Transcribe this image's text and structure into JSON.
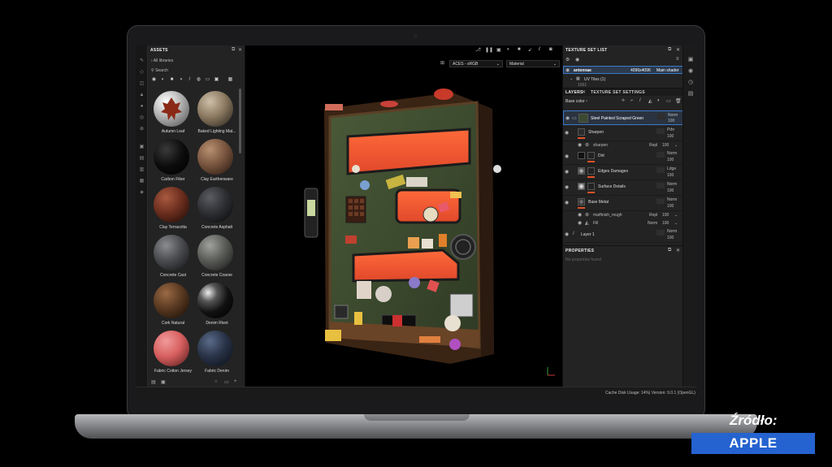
{
  "caption": {
    "source_label": "Źródło:",
    "badge": "APPLE"
  },
  "assets": {
    "title": "ASSETS",
    "library": "All libraries",
    "search_placeholder": "Search",
    "items": [
      {
        "label": "Autumn Leaf",
        "color": "#c8c8c8"
      },
      {
        "label": "Baked Lighting Mat...",
        "color": "#8c7a62"
      },
      {
        "label": "Carbon Fiber",
        "color": "#0c0c0c"
      },
      {
        "label": "Clay Earthenware",
        "color": "#7a5640"
      },
      {
        "label": "Clay Terracotta",
        "color": "#6e2f1f"
      },
      {
        "label": "Concrete Asphalt",
        "color": "#2e3034"
      },
      {
        "label": "Concrete Cast",
        "color": "#4a4c4f"
      },
      {
        "label": "Concrete Coarse",
        "color": "#5a5c58"
      },
      {
        "label": "Cork Natural",
        "color": "#5a3a22"
      },
      {
        "label": "Denim Rivet",
        "color": "#1a1a1a"
      },
      {
        "label": "Fabric Cotton Jersey",
        "color": "#d86060"
      },
      {
        "label": "Fabric Denim",
        "color": "#2a3448"
      }
    ]
  },
  "viewport": {
    "color_space": "ACES - sRGB",
    "channel": "Material"
  },
  "texture_set_list": {
    "title": "TEXTURE SET LIST",
    "set_name": "antennae",
    "resolution": "4096x4096",
    "shader": "Main shader",
    "uv_tiles": "UV Tiles (1)",
    "uv_sub": "1001"
  },
  "layers": {
    "tab_layers": "LAYERS",
    "tab_settings": "TEXTURE SET SETTINGS",
    "channel": "Base color",
    "rows": [
      {
        "name": "Steel Painted Scraped Green",
        "blend": "Norm",
        "opacity": "100",
        "selected": true
      },
      {
        "name": "Sharpen",
        "blend": "Pthr",
        "opacity": "100"
      },
      {
        "name": "sharpen",
        "blend": "Repl",
        "opacity": "100",
        "sub": true
      },
      {
        "name": "Dirt",
        "blend": "Norm",
        "opacity": "100"
      },
      {
        "name": "Edges Damages",
        "blend": "Ldge",
        "opacity": "100"
      },
      {
        "name": "Surface Details",
        "blend": "Norm",
        "opacity": "100"
      },
      {
        "name": "Base Metal",
        "blend": "Norm",
        "opacity": "100"
      },
      {
        "name": "matfinish_rough",
        "blend": "Repl",
        "opacity": "100",
        "sub": true
      },
      {
        "name": "Fill",
        "blend": "Norm",
        "opacity": "100",
        "sub": true
      },
      {
        "name": "Layer 1",
        "blend": "Norm",
        "opacity": "100"
      }
    ]
  },
  "properties": {
    "title": "PROPERTIES",
    "empty": "No properties found"
  },
  "status": {
    "cache_label": "Cache Disk Usage:",
    "cache_value": "14%",
    "version": "| Version: 9.0.1 (OpenGL)"
  }
}
